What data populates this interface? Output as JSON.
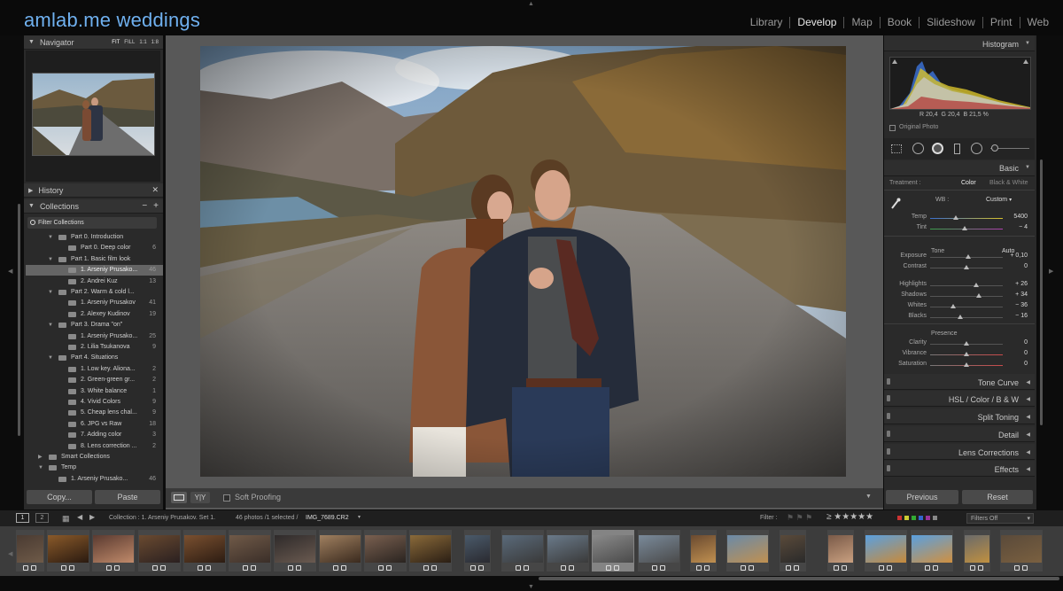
{
  "brand": {
    "title": "amlab.me weddings"
  },
  "modules": [
    "Library",
    "Develop",
    "Map",
    "Book",
    "Slideshow",
    "Print",
    "Web"
  ],
  "active_module": "Develop",
  "navigator": {
    "title": "Navigator",
    "zoom": [
      "FIT",
      "FILL",
      "1:1",
      "1:8"
    ]
  },
  "history": {
    "title": "History"
  },
  "collections": {
    "title": "Collections",
    "filter_label": "Filter Collections",
    "items": [
      {
        "label": "Part 0. Introduction",
        "count": "",
        "level": 1,
        "type": "set"
      },
      {
        "label": "Part 0. Deep color",
        "count": "6",
        "level": 2,
        "type": "coll"
      },
      {
        "label": "Part 1. Basic film look",
        "count": "",
        "level": 1,
        "type": "set"
      },
      {
        "label": "1. Arseniy Prusako...",
        "count": "46",
        "level": 2,
        "type": "coll",
        "selected": true
      },
      {
        "label": "2. Andrei Kuz",
        "count": "13",
        "level": 2,
        "type": "coll"
      },
      {
        "label": "Part 2. Warm & cold l...",
        "count": "",
        "level": 1,
        "type": "set"
      },
      {
        "label": "1. Arseniy Prusakov",
        "count": "41",
        "level": 2,
        "type": "coll"
      },
      {
        "label": "2. Alexey Kudinov",
        "count": "19",
        "level": 2,
        "type": "coll"
      },
      {
        "label": "Part 3. Drama \"on\"",
        "count": "",
        "level": 1,
        "type": "set"
      },
      {
        "label": "1. Arseniy Prusako...",
        "count": "25",
        "level": 2,
        "type": "coll"
      },
      {
        "label": "2. Lilia Tsukanova",
        "count": "9",
        "level": 2,
        "type": "coll"
      },
      {
        "label": "Part 4. Situations",
        "count": "",
        "level": 1,
        "type": "set"
      },
      {
        "label": "1. Low key. Aliona...",
        "count": "2",
        "level": 2,
        "type": "coll"
      },
      {
        "label": "2. Green-green gr...",
        "count": "2",
        "level": 2,
        "type": "coll"
      },
      {
        "label": "3. White balance",
        "count": "1",
        "level": 2,
        "type": "coll"
      },
      {
        "label": "4. Vivid Colors",
        "count": "9",
        "level": 2,
        "type": "coll"
      },
      {
        "label": "5. Cheap lens chal...",
        "count": "9",
        "level": 2,
        "type": "coll"
      },
      {
        "label": "6. JPG vs Raw",
        "count": "18",
        "level": 2,
        "type": "coll"
      },
      {
        "label": "7. Adding color",
        "count": "3",
        "level": 2,
        "type": "coll"
      },
      {
        "label": "8. Lens correction ...",
        "count": "2",
        "level": 2,
        "type": "coll"
      },
      {
        "label": "Smart Collections",
        "count": "",
        "level": 0,
        "type": "set"
      },
      {
        "label": "Temp",
        "count": "",
        "level": 0,
        "type": "set"
      },
      {
        "label": "1. Arseniy Prusako...",
        "count": "46",
        "level": 1,
        "type": "coll"
      }
    ]
  },
  "left_buttons": {
    "copy": "Copy...",
    "paste": "Paste"
  },
  "toolbar": {
    "soft_proofing": "Soft Proofing",
    "yy": "Y|Y"
  },
  "histogram": {
    "title": "Histogram",
    "rgb": {
      "r_label": "R",
      "r": "20,4",
      "g_label": "G",
      "g": "20,4",
      "b_label": "B",
      "b": "21,5",
      "unit": "%"
    },
    "original": "Original Photo"
  },
  "basic": {
    "title": "Basic",
    "treatment_label": "Treatment :",
    "treatment_color": "Color",
    "treatment_bw": "Black & White",
    "wb_label": "WB :",
    "wb_value": "Custom",
    "tone_label": "Tone",
    "auto_label": "Auto",
    "presence_label": "Presence",
    "sliders": [
      {
        "label": "Temp",
        "value": "5400",
        "pos": 0.35
      },
      {
        "label": "Tint",
        "value": "− 4",
        "pos": 0.48
      },
      {
        "label": "Exposure",
        "value": "+ 0,10",
        "pos": 0.52
      },
      {
        "label": "Contrast",
        "value": "0",
        "pos": 0.5
      },
      {
        "label": "Highlights",
        "value": "+ 26",
        "pos": 0.63
      },
      {
        "label": "Shadows",
        "value": "+ 34",
        "pos": 0.67
      },
      {
        "label": "Whites",
        "value": "− 36",
        "pos": 0.32
      },
      {
        "label": "Blacks",
        "value": "− 16",
        "pos": 0.42
      },
      {
        "label": "Clarity",
        "value": "0",
        "pos": 0.5
      },
      {
        "label": "Vibrance",
        "value": "0",
        "pos": 0.5
      },
      {
        "label": "Saturation",
        "value": "0",
        "pos": 0.5
      }
    ]
  },
  "right_sections": [
    {
      "label": "Tone Curve"
    },
    {
      "label": "HSL  /  Color  /  B & W"
    },
    {
      "label": "Split Toning"
    },
    {
      "label": "Detail"
    },
    {
      "label": "Lens Corrections"
    },
    {
      "label": "Effects"
    }
  ],
  "right_buttons": {
    "previous": "Previous",
    "reset": "Reset"
  },
  "filmstrip_bar": {
    "view1": "1",
    "view2": "2",
    "path": "Collection : 1. Arseniy Prusakov. Set 1.",
    "count": "46 photos /1 selected /",
    "filename": "IMG_7689.CR2",
    "filter_label": "Filter :",
    "filters_off": "Filters Off"
  },
  "colors": {
    "brand": "#6fb0ef",
    "panel": "#2a2a2a",
    "center": "#585858"
  }
}
